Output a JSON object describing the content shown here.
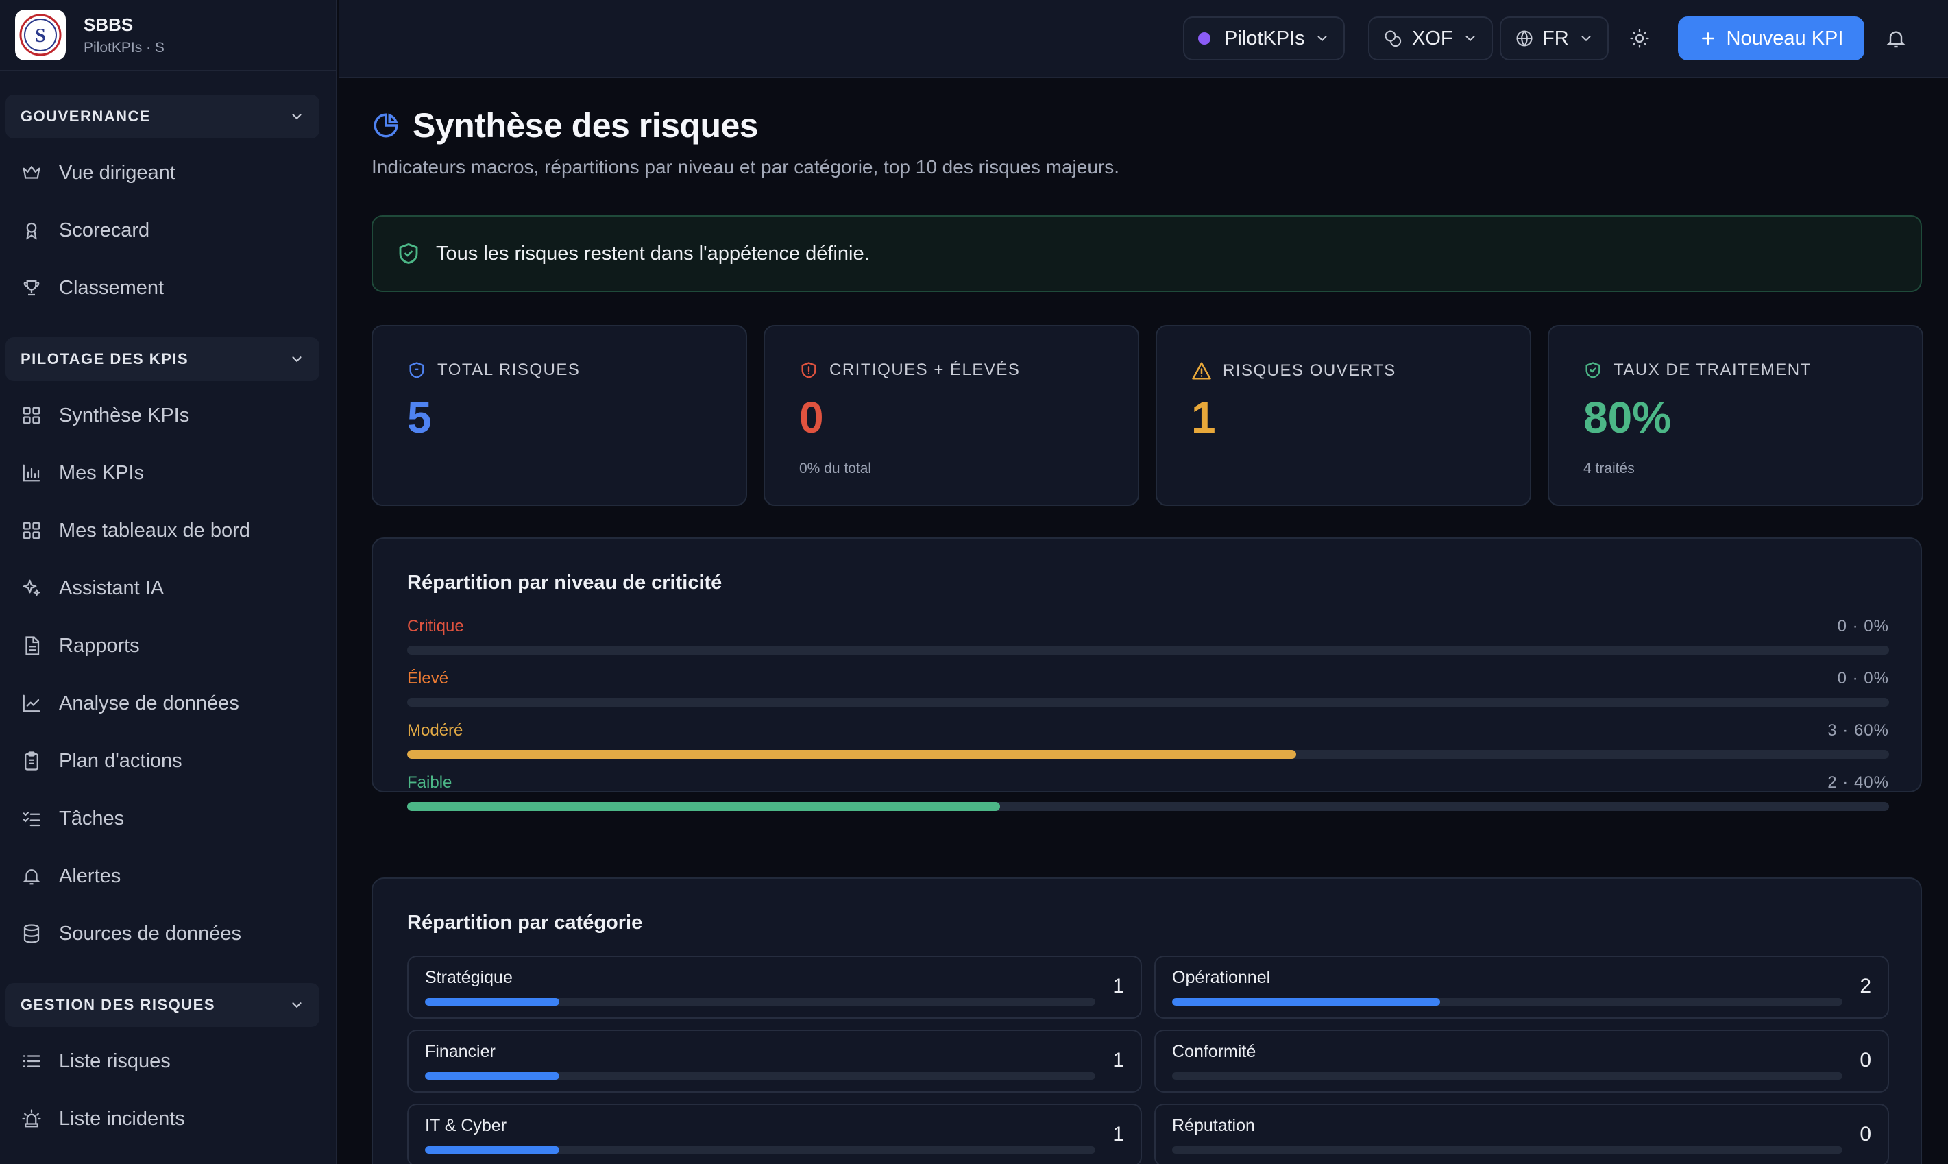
{
  "brand": {
    "name": "SBBS",
    "subtitle": "PilotKPIs · S"
  },
  "sidebar": {
    "groups": [
      {
        "label": "GOUVERNANCE",
        "items": [
          {
            "label": "Vue dirigeant",
            "icon": "crown-icon"
          },
          {
            "label": "Scorecard",
            "icon": "award-icon"
          },
          {
            "label": "Classement",
            "icon": "trophy-icon"
          }
        ]
      },
      {
        "label": "PILOTAGE DES KPIS",
        "items": [
          {
            "label": "Synthèse KPIs",
            "icon": "grid-icon"
          },
          {
            "label": "Mes KPIs",
            "icon": "bar-chart-icon"
          },
          {
            "label": "Mes tableaux de bord",
            "icon": "dashboard-icon"
          },
          {
            "label": "Assistant IA",
            "icon": "sparkles-icon"
          },
          {
            "label": "Rapports",
            "icon": "file-icon"
          },
          {
            "label": "Analyse de données",
            "icon": "line-chart-icon"
          },
          {
            "label": "Plan d'actions",
            "icon": "clipboard-icon"
          },
          {
            "label": "Tâches",
            "icon": "list-checks-icon"
          },
          {
            "label": "Alertes",
            "icon": "bell-icon"
          },
          {
            "label": "Sources de données",
            "icon": "database-icon"
          }
        ]
      },
      {
        "label": "GESTION DES RISQUES",
        "items": [
          {
            "label": "Liste risques",
            "icon": "list-icon"
          },
          {
            "label": "Liste incidents",
            "icon": "siren-icon"
          }
        ]
      }
    ]
  },
  "topbar": {
    "workspace": "PilotKPIs",
    "currency": "XOF",
    "language": "FR",
    "new_kpi_label": "Nouveau KPI"
  },
  "page": {
    "title": "Synthèse des risques",
    "subtitle": "Indicateurs macros, répartitions par niveau et par catégorie, top 10 des risques majeurs.",
    "alert": "Tous les risques restent dans l'appétence définie."
  },
  "kpis": [
    {
      "label": "TOTAL RISQUES",
      "value": "5",
      "sub": "",
      "color": "#4f83f1"
    },
    {
      "label": "CRITIQUES + ÉLEVÉS",
      "value": "0",
      "sub": "0% du total",
      "color": "#e0533f"
    },
    {
      "label": "RISQUES OUVERTS",
      "value": "1",
      "sub": "",
      "color": "#e8a83a"
    },
    {
      "label": "TAUX DE TRAITEMENT",
      "value": "80%",
      "sub": "4 traités",
      "color": "#4cb787"
    }
  ],
  "levels": {
    "title": "Répartition par niveau de criticité",
    "items": [
      {
        "label": "Critique",
        "count_text": "0 · 0%",
        "ratio": 0,
        "color": "#e0533f"
      },
      {
        "label": "Élevé",
        "count_text": "0 · 0%",
        "ratio": 0,
        "color": "#ec7b33"
      },
      {
        "label": "Modéré",
        "count_text": "3 · 60%",
        "ratio": 0.6,
        "color": "#e2aa45"
      },
      {
        "label": "Faible",
        "count_text": "2 · 40%",
        "ratio": 0.4,
        "color": "#4cb787"
      }
    ]
  },
  "categories": {
    "title": "Répartition par catégorie",
    "items": [
      {
        "label": "Stratégique",
        "count": "1",
        "ratio": 0.2
      },
      {
        "label": "Opérationnel",
        "count": "2",
        "ratio": 0.4
      },
      {
        "label": "Financier",
        "count": "1",
        "ratio": 0.2
      },
      {
        "label": "Conformité",
        "count": "0",
        "ratio": 0
      },
      {
        "label": "IT & Cyber",
        "count": "1",
        "ratio": 0.2
      },
      {
        "label": "Réputation",
        "count": "0",
        "ratio": 0
      }
    ]
  }
}
